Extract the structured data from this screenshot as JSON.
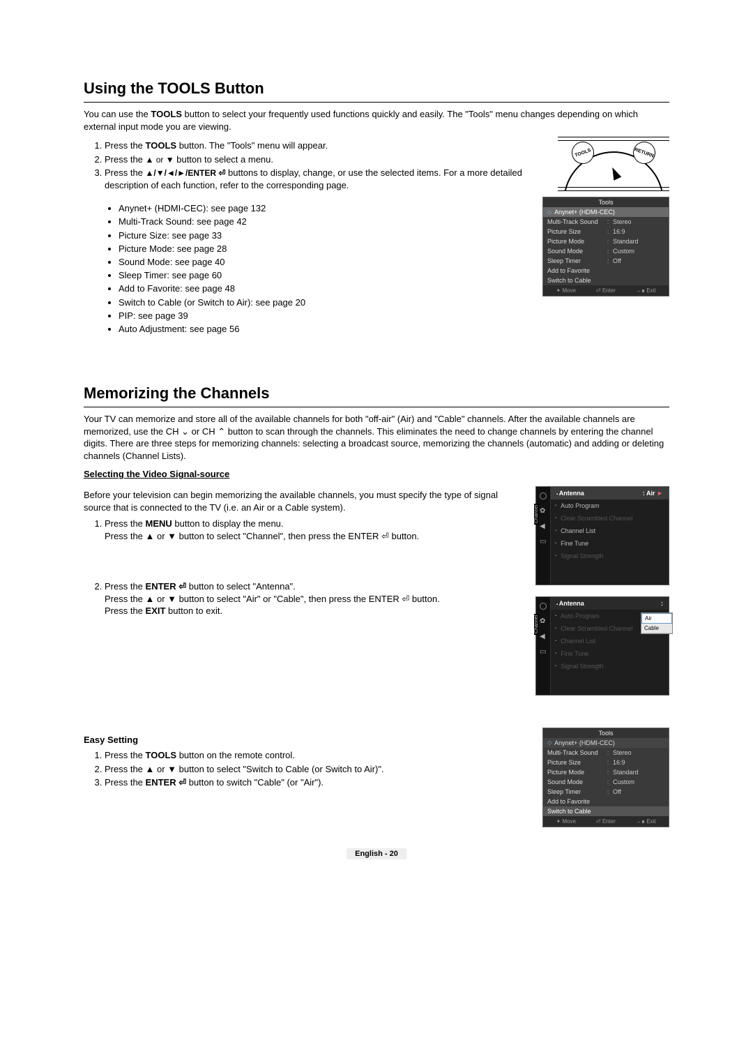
{
  "section1": {
    "title": "Using the TOOLS Button",
    "intro_a": "You can use the ",
    "intro_b": "TOOLS",
    "intro_c": " button to select your frequently used functions quickly and easily. The \"Tools\" menu changes depending on which external input mode you are viewing.",
    "step1_a": "Press the ",
    "step1_b": "TOOLS",
    "step1_c": " button. The \"Tools\" menu will appear.",
    "step2_a": "Press the ",
    "step2_arrows": "▲ or ▼",
    "step2_b": " button to select a menu.",
    "step3_a": "Press the ",
    "step3_arrows": "▲/▼/◄/►/ENTER ⏎",
    "step3_b": " buttons to display, change, or use the selected items. For a more detailed description of each function, refer to the corresponding page.",
    "bullets": [
      "Anynet+ (HDMI-CEC): see page 132",
      "Multi-Track Sound: see page 42",
      "Picture Size: see page 33",
      "Picture Mode: see page 28",
      "Sound Mode: see page 40",
      "Sleep Timer: see page 60",
      "Add to Favorite: see page 48",
      "Switch to Cable (or Switch to Air): see page 20",
      "PIP: see page 39",
      "Auto Adjustment: see page 56"
    ],
    "remote": {
      "left_btn": "TOOLS",
      "right_btn": "RETURN"
    }
  },
  "tools_osd": {
    "title": "Tools",
    "highlight": "Anynet+ (HDMI-CEC)",
    "rows": [
      {
        "label": "Multi-Track Sound",
        "value": "Stereo"
      },
      {
        "label": "Picture Size",
        "value": "16:9"
      },
      {
        "label": "Picture Mode",
        "value": "Standard"
      },
      {
        "label": "Sound Mode",
        "value": "Custom"
      },
      {
        "label": "Sleep Timer",
        "value": "Off"
      },
      {
        "label": "Add to Favorite",
        "value": ""
      },
      {
        "label": "Switch to Cable",
        "value": ""
      }
    ],
    "footer": {
      "move": "Move",
      "enter": "Enter",
      "exit": "Exit"
    }
  },
  "section2": {
    "title": "Memorizing the Channels",
    "intro": "Your TV can memorize and store all of the available channels for both \"off-air\" (Air) and \"Cable\" channels. After the available channels are memorized, use the CH ⌄ or CH ⌃ button to scan through the channels. This eliminates the need to change channels by entering the channel digits. There are three steps for memorizing channels: selecting a broadcast source, memorizing the channels (automatic) and adding or deleting channels (Channel Lists).",
    "subhead1": "Selecting the Video Signal-source",
    "pre1": "Before your television can begin memorizing the available channels, you must specify the type of signal source that is connected to the TV (i.e. an Air or a Cable system).",
    "s1_step1_a": "Press the ",
    "s1_step1_b": "MENU",
    "s1_step1_c": " button to display the menu.",
    "s1_step1_line2": "Press the ▲ or ▼ button to select \"Channel\", then press the ENTER ⏎ button.",
    "s1_step2_a": "Press the ",
    "s1_step2_b": "ENTER ⏎",
    "s1_step2_c": " button to select \"Antenna\".",
    "s1_step2_line2": "Press the ▲ or ▼ button to select \"Air\" or \"Cable\", then press the ENTER ⏎ button.",
    "s1_step2_line3_a": "Press the ",
    "s1_step2_line3_b": "EXIT",
    "s1_step2_line3_c": " button to exit.",
    "subhead2": "Easy Setting",
    "s2_step1_a": "Press the ",
    "s2_step1_b": "TOOLS",
    "s2_step1_c": " button on the remote control.",
    "s2_step2": "Press the ▲ or ▼ button to select \"Switch to Cable (or Switch to Air)\".",
    "s2_step3_a": "Press the ",
    "s2_step3_b": "ENTER ⏎",
    "s2_step3_c": " button to switch \"Cable\" (or \"Air\")."
  },
  "channel_osd": {
    "vlabel": "Channel",
    "hl_label": "Antenna",
    "hl_value": ": Air",
    "arrow": "►",
    "items": [
      "Auto Program",
      "Clear Scrambled Channel",
      "Channel List",
      "Fine Tune",
      "Signal Strength"
    ],
    "dropdown": [
      "Air",
      "Cable"
    ]
  },
  "tools_osd2_selected": "Switch to Cable",
  "footer": "English - 20",
  "glyphs": {
    "move": "✦",
    "enter": "⏎",
    "exit": "→∎",
    "updown": "✦"
  }
}
